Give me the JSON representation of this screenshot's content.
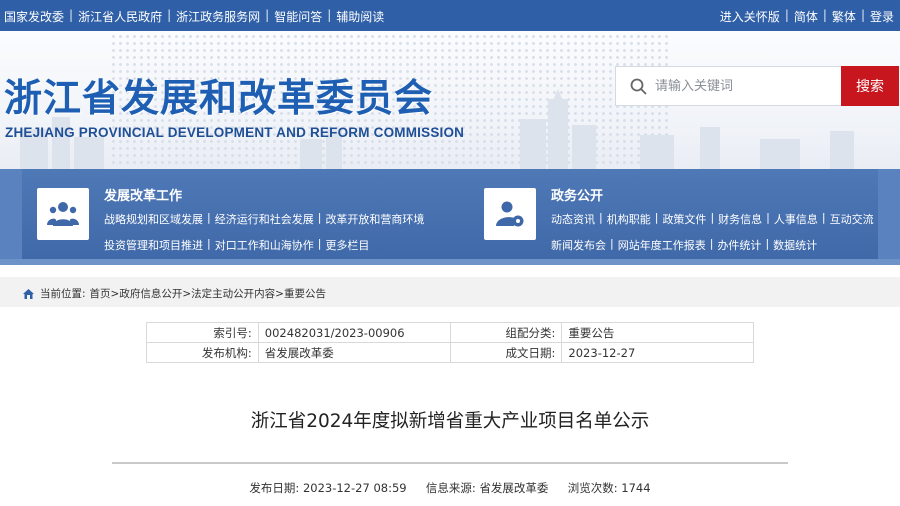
{
  "topbar": {
    "left_links": [
      "国家发改委",
      "浙江省人民政府",
      "浙江政务服务网",
      "智能问答",
      "辅助阅读"
    ],
    "right_links": [
      "进入关怀版",
      "简体",
      "繁体",
      "登录"
    ]
  },
  "header": {
    "title": "浙江省发展和改革委员会",
    "title_en": "ZHEJIANG PROVINCIAL DEVELOPMENT AND REFORM COMMISSION",
    "search_placeholder": "请输入关键词",
    "search_button": "搜索"
  },
  "nav": {
    "blocks": [
      {
        "title": "发展改革工作",
        "icon": "people-group-icon",
        "rows": [
          [
            "战略规划和区域发展",
            "经济运行和社会发展",
            "改革开放和营商环境"
          ],
          [
            "投资管理和项目推进",
            "对口工作和山海协作",
            "更多栏目"
          ]
        ]
      },
      {
        "title": "政务公开",
        "icon": "user-gear-icon",
        "rows": [
          [
            "动态资讯",
            "机构职能",
            "政策文件",
            "财务信息",
            "人事信息",
            "互动交流"
          ],
          [
            "新闻发布会",
            "网站年度工作报表",
            "办件统计",
            "数据统计"
          ]
        ]
      }
    ]
  },
  "breadcrumb": {
    "label": "当前位置:",
    "items": [
      "首页",
      "政府信息公开",
      "法定主动公开内容",
      "重要公告"
    ],
    "separator": ">"
  },
  "meta": {
    "index_label": "索引号:",
    "index_value": "002482031/2023-00906",
    "category_label": "组配分类:",
    "category_value": "重要公告",
    "publisher_label": "发布机构:",
    "publisher_value": "省发展改革委",
    "date_label": "成文日期:",
    "date_value": "2023-12-27"
  },
  "article": {
    "title": "浙江省2024年度拟新增省重大产业项目名单公示",
    "publish_label": "发布日期:",
    "publish_value": "2023-12-27 08:59",
    "source_label": "信息来源:",
    "source_value": "省发展改革委",
    "views_label": "浏览次数:",
    "views_value": "1744"
  },
  "colors": {
    "topbar": "#2f5fa7",
    "title_blue": "#1e5fb3",
    "nav_blue": "#4671b0",
    "search_red": "#c8161e"
  }
}
